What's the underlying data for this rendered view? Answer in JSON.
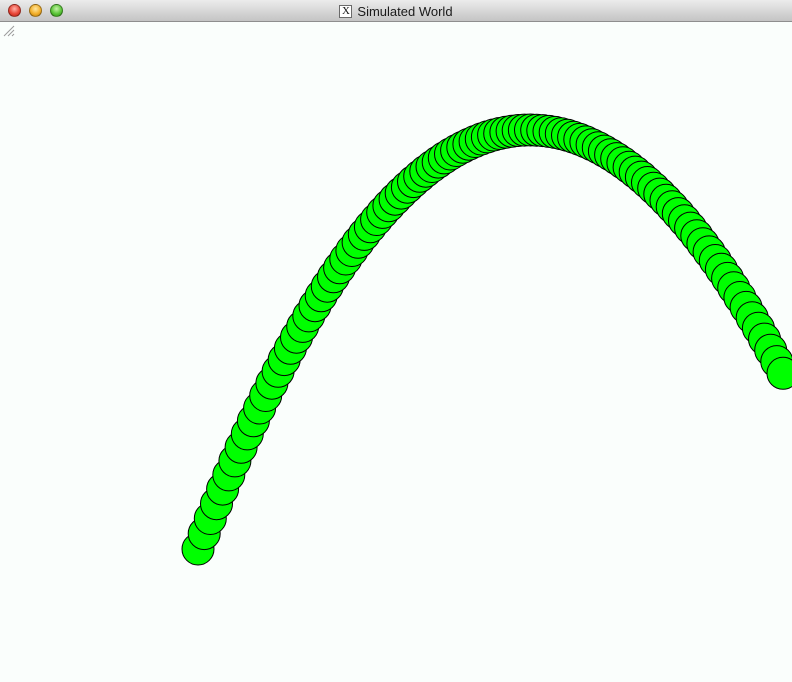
{
  "window": {
    "title": "Simulated World",
    "x11_glyph": "X"
  },
  "icons": {
    "close": "close-button",
    "minimize": "minimize-button",
    "zoom": "zoom-button",
    "app": "x11-icon",
    "resize": "resize-grip-icon"
  },
  "colors": {
    "ball_fill": "#00ff00",
    "ball_stroke": "#000000",
    "canvas_background": "#fafefc"
  },
  "simulation": {
    "ball_count": 96
  }
}
